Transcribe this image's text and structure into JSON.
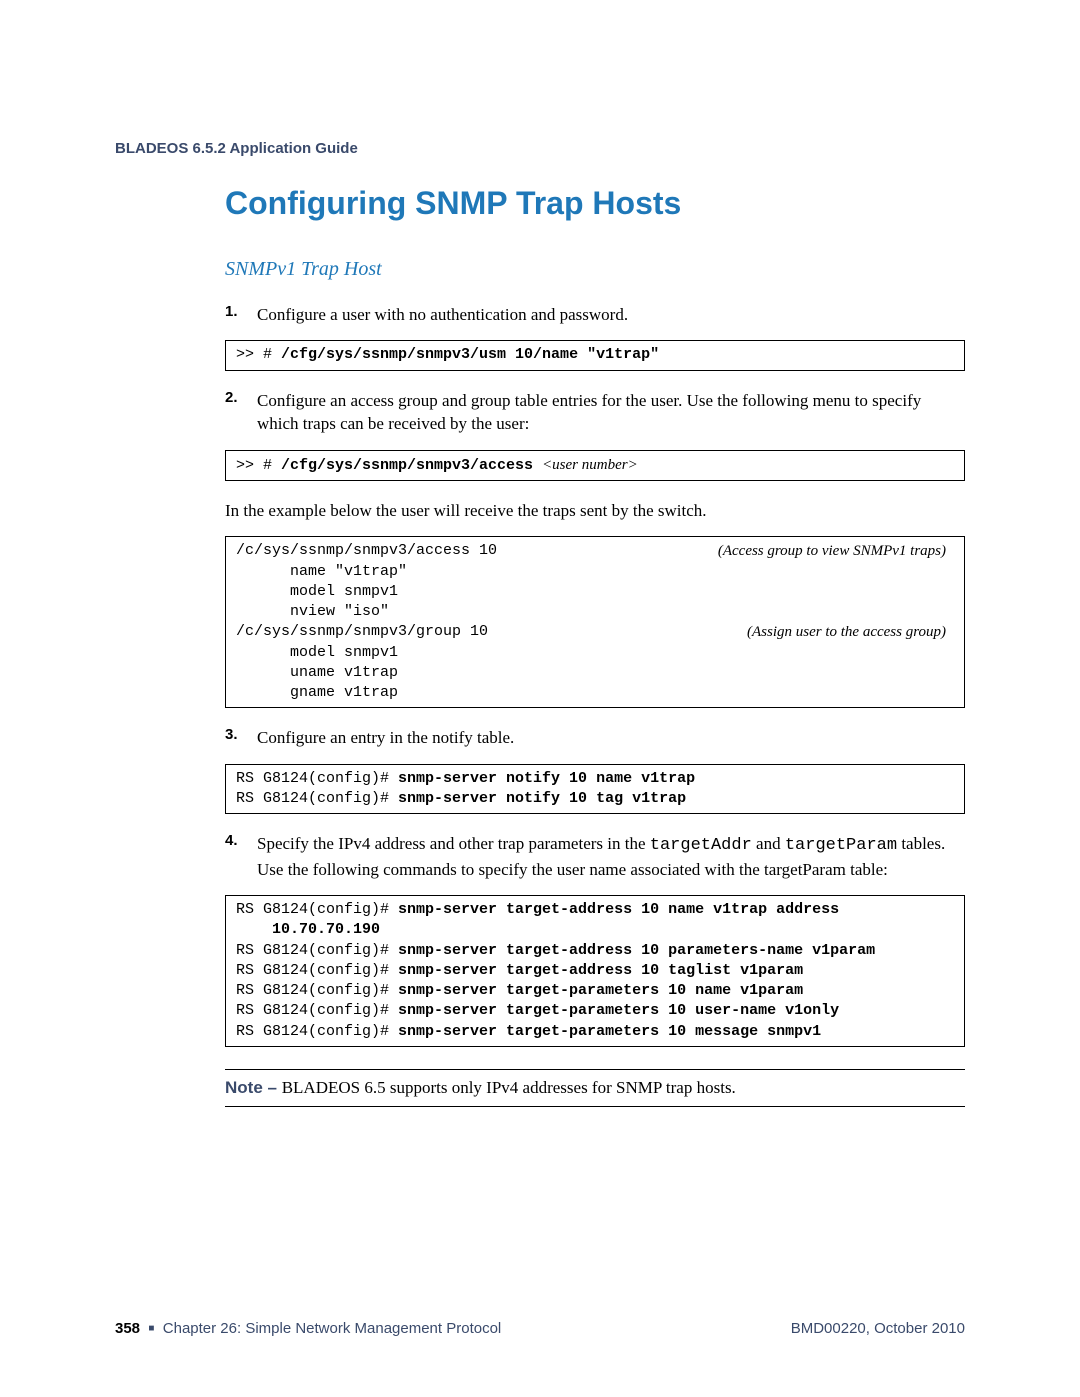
{
  "header": "BLADEOS 6.5.2 Application Guide",
  "title": "Configuring SNMP Trap Hosts",
  "subtitle": "SNMPv1 Trap Host",
  "steps": {
    "s1": {
      "num": "1.",
      "text": "Configure a user with no authentication and password.",
      "code_prefix": ">> # ",
      "code_cmd": "/cfg/sys/ssnmp/snmpv3/usm 10/name \"v1trap\""
    },
    "s2": {
      "num": "2.",
      "text": "Configure an access group and group table entries for the user. Use the following menu to specify which traps can be received by the user:",
      "code_prefix": ">> # ",
      "code_cmd": "/cfg/sys/ssnmp/snmpv3/access ",
      "code_arg": "<user number>",
      "followup": "In the example below the user will receive the traps sent by the switch.",
      "example": {
        "l1_left": "/c/sys/ssnmp/snmpv3/access 10",
        "l1_right": "(Access group to view SNMPv1 traps)",
        "l2": "      name \"v1trap\"",
        "l3": "      model snmpv1",
        "l4": "      nview \"iso\"",
        "l5_left": "/c/sys/ssnmp/snmpv3/group 10",
        "l5_right": "(Assign user to the access group)",
        "l6": "      model snmpv1",
        "l7": "      uname v1trap",
        "l8": "      gname v1trap"
      }
    },
    "s3": {
      "num": "3.",
      "text": "Configure an entry in the notify table.",
      "code": {
        "p1a": "RS G8124(config)# ",
        "p1b": "snmp-server notify 10 name v1trap",
        "p2a": "RS G8124(config)# ",
        "p2b": "snmp-server notify 10 tag v1trap"
      }
    },
    "s4": {
      "num": "4.",
      "text_a": "Specify the IPv4 address and other trap parameters in the ",
      "text_mono1": "targetAddr",
      "text_b": " and ",
      "text_mono2": "targetParam",
      "text_c": " tables. Use the following commands to specify the user name associated with the targetParam table:",
      "code": {
        "p1a": "RS G8124(config)# ",
        "p1b": "snmp-server target-address 10 name v1trap address ",
        "p1c": "    10.70.70.190",
        "p2a": "RS G8124(config)# ",
        "p2b": "snmp-server target-address 10 parameters-name v1param",
        "p3a": "RS G8124(config)# ",
        "p3b": "snmp-server target-address 10 taglist v1param",
        "p4a": "RS G8124(config)# ",
        "p4b": "snmp-server target-parameters 10 name v1param",
        "p5a": "RS G8124(config)# ",
        "p5b": "snmp-server target-parameters 10 user-name v1only",
        "p6a": "RS G8124(config)# ",
        "p6b": "snmp-server target-parameters 10 message snmpv1"
      }
    }
  },
  "note": {
    "label": "Note – ",
    "text": "BLADEOS 6.5 supports only IPv4 addresses for SNMP trap hosts."
  },
  "footer": {
    "page": "358",
    "square": "■",
    "chapter": "Chapter 26: Simple Network Management Protocol",
    "docid": "BMD00220, October 2010"
  }
}
